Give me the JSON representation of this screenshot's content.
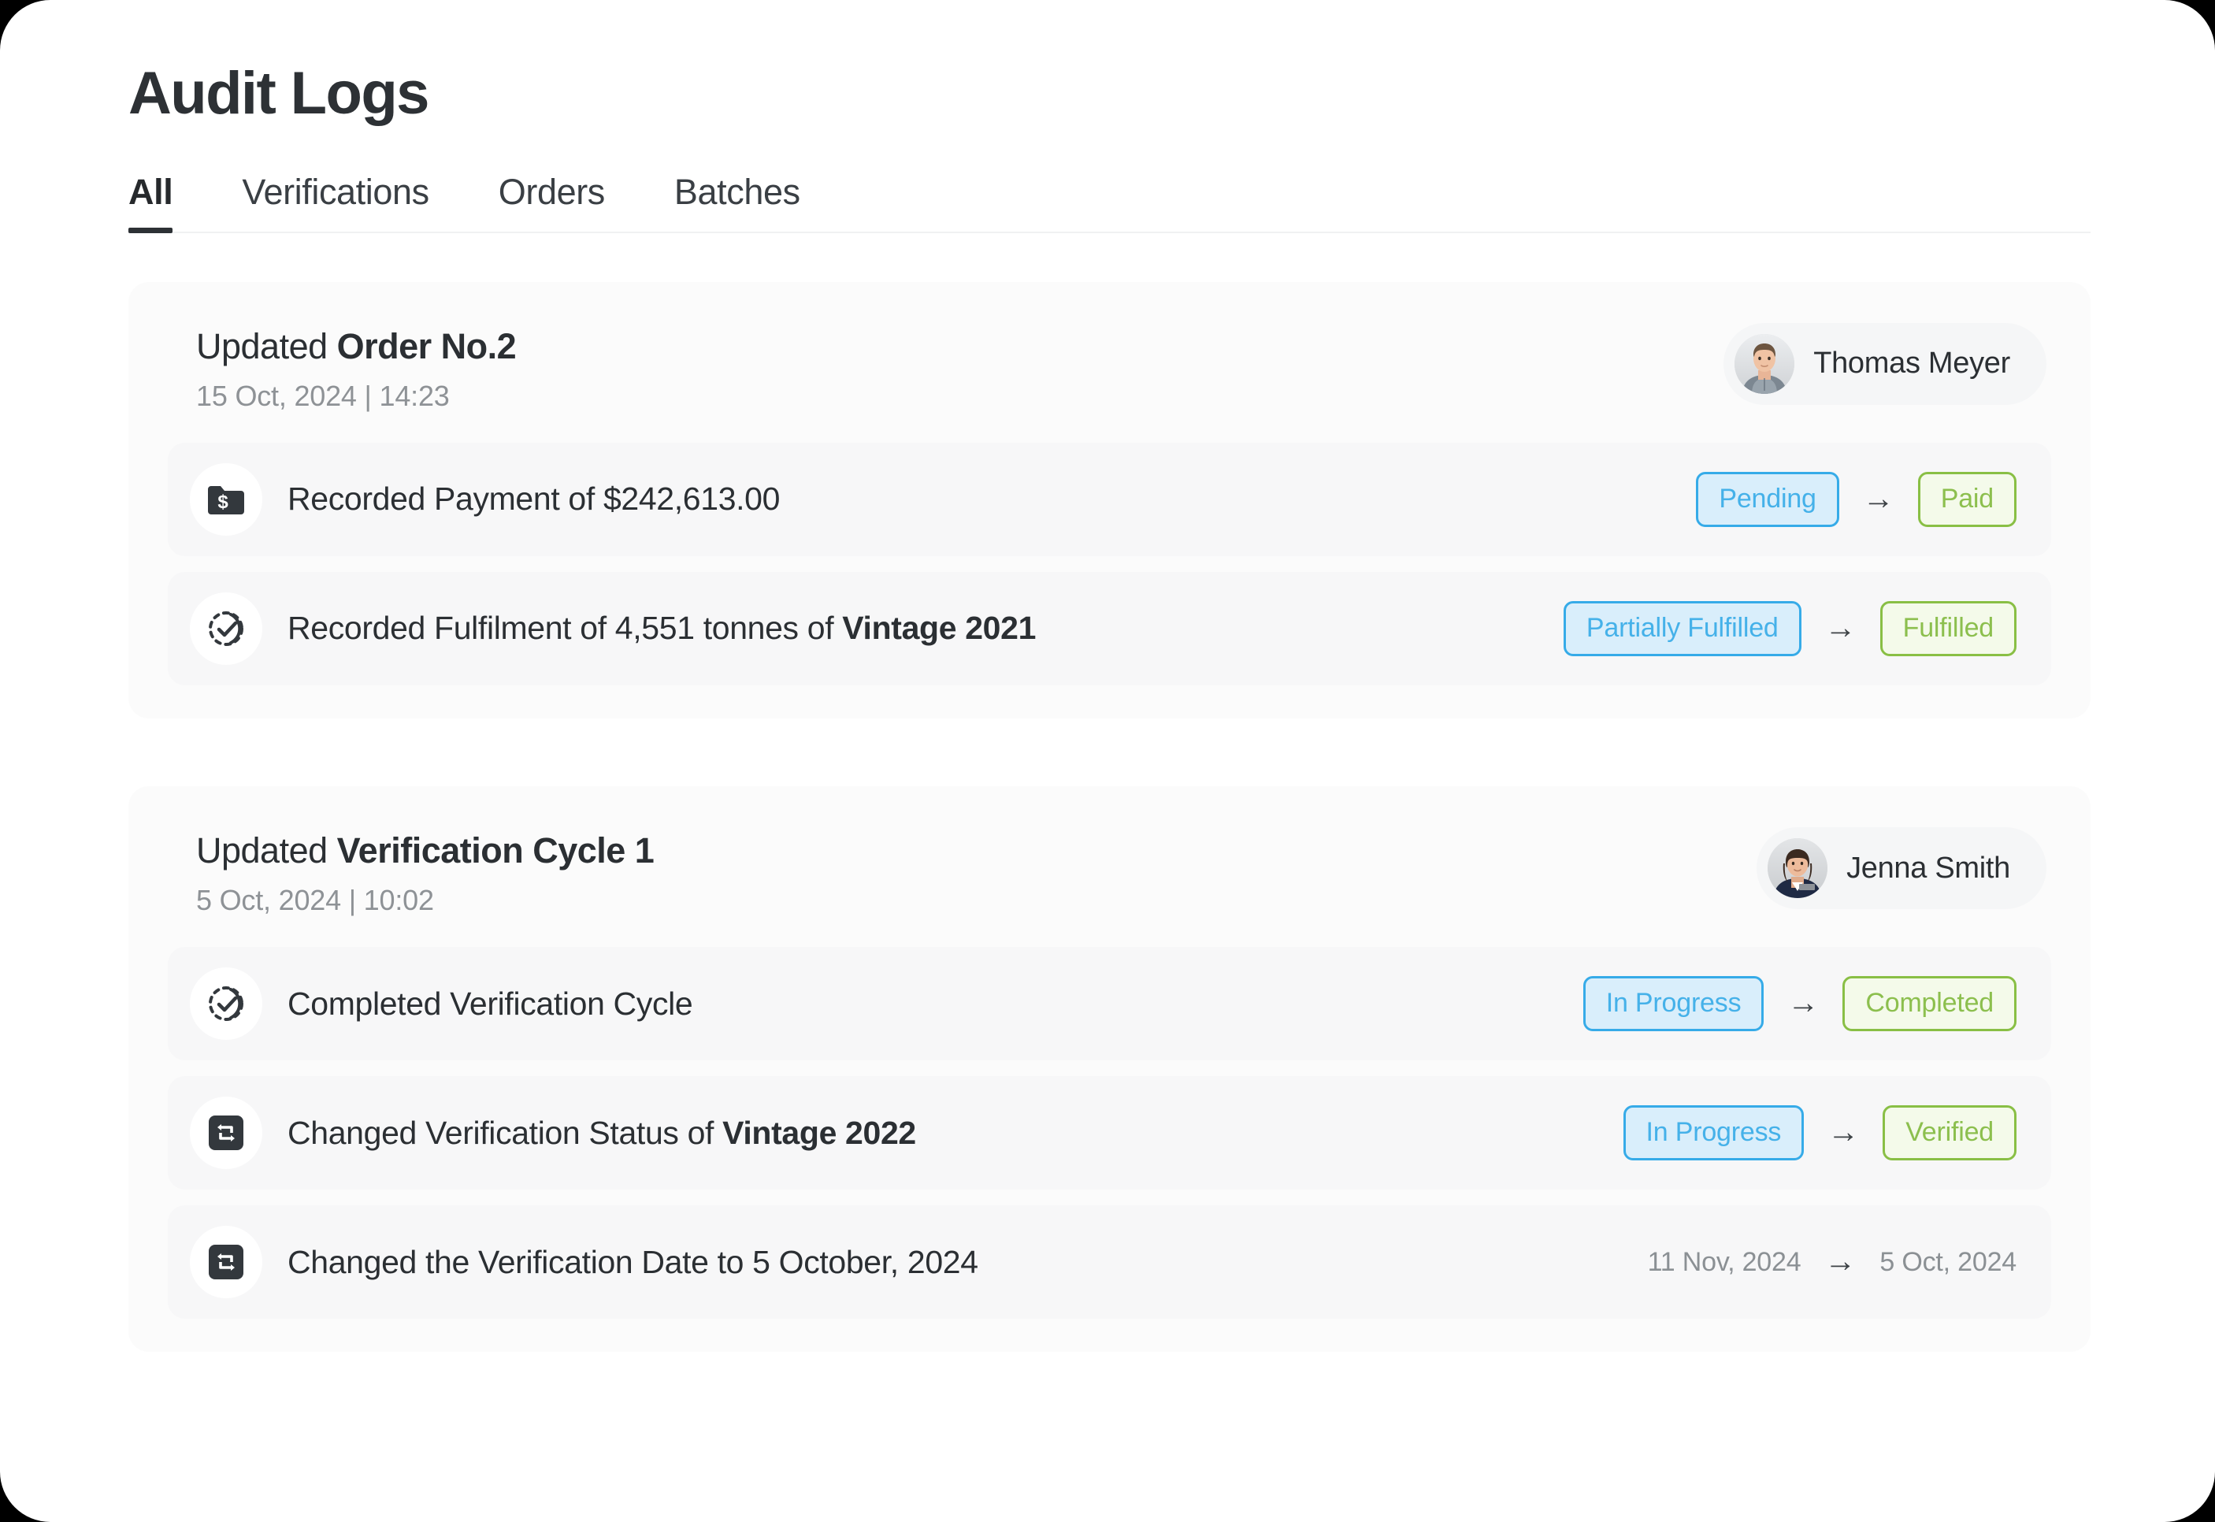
{
  "page": {
    "title": "Audit Logs"
  },
  "tabs": {
    "items": [
      {
        "label": "All",
        "active": true
      },
      {
        "label": "Verifications",
        "active": false
      },
      {
        "label": "Orders",
        "active": false
      },
      {
        "label": "Batches",
        "active": false
      }
    ]
  },
  "colors": {
    "status_blue_text": "#45b1e9",
    "status_blue_border": "#36abe8",
    "status_blue_bg": "#d9eefb",
    "status_green_text": "#8cbf4e",
    "status_green_border": "#89bf45",
    "status_green_bg": "#f4faea",
    "page_bg": "#ffffff",
    "card_bg": "#fbfbfb",
    "row_bg": "#f7f7f8",
    "title_text": "#2d3135",
    "muted_text": "#8e9296"
  },
  "cards": [
    {
      "title_prefix": "Updated ",
      "title_strong": "Order No.2",
      "timestamp": "15 Oct,  2024 | 14:23",
      "user": {
        "name": "Thomas Meyer",
        "avatar": "avatar-thomas-meyer"
      },
      "rows": [
        {
          "icon": "folder-dollar-icon",
          "label_prefix": "Recorded Payment of $242,613.00",
          "label_strong": "",
          "from": {
            "text": "Pending",
            "style": "blue"
          },
          "to": {
            "text": "Paid",
            "style": "green"
          },
          "arrow": "→"
        },
        {
          "icon": "dashed-check-circle-icon",
          "label_prefix": "Recorded Fulfilment of 4,551 tonnes of ",
          "label_strong": "Vintage 2021",
          "from": {
            "text": "Partially Fulfilled",
            "style": "blue"
          },
          "to": {
            "text": "Fulfilled",
            "style": "green"
          },
          "arrow": "→"
        }
      ]
    },
    {
      "title_prefix": "Updated ",
      "title_strong": "Verification Cycle 1",
      "timestamp": "5 Oct, 2024 | 10:02",
      "user": {
        "name": "Jenna Smith",
        "avatar": "avatar-jenna-smith"
      },
      "rows": [
        {
          "icon": "dashed-check-circle-icon",
          "label_prefix": "Completed Verification Cycle",
          "label_strong": "",
          "from": {
            "text": "In Progress",
            "style": "blue"
          },
          "to": {
            "text": "Completed",
            "style": "green"
          },
          "arrow": "→"
        },
        {
          "icon": "swap-arrows-icon",
          "label_prefix": "Changed Verification Status of ",
          "label_strong": "Vintage 2022",
          "from": {
            "text": "In Progress",
            "style": "blue"
          },
          "to": {
            "text": "Verified",
            "style": "green"
          },
          "arrow": "→"
        },
        {
          "icon": "swap-arrows-icon",
          "label_prefix": "Changed the Verification Date to 5 October, 2024",
          "label_strong": "",
          "from": {
            "text": "11 Nov, 2024",
            "style": "plain"
          },
          "to": {
            "text": "5 Oct, 2024",
            "style": "plain"
          },
          "arrow": "→"
        }
      ]
    }
  ]
}
